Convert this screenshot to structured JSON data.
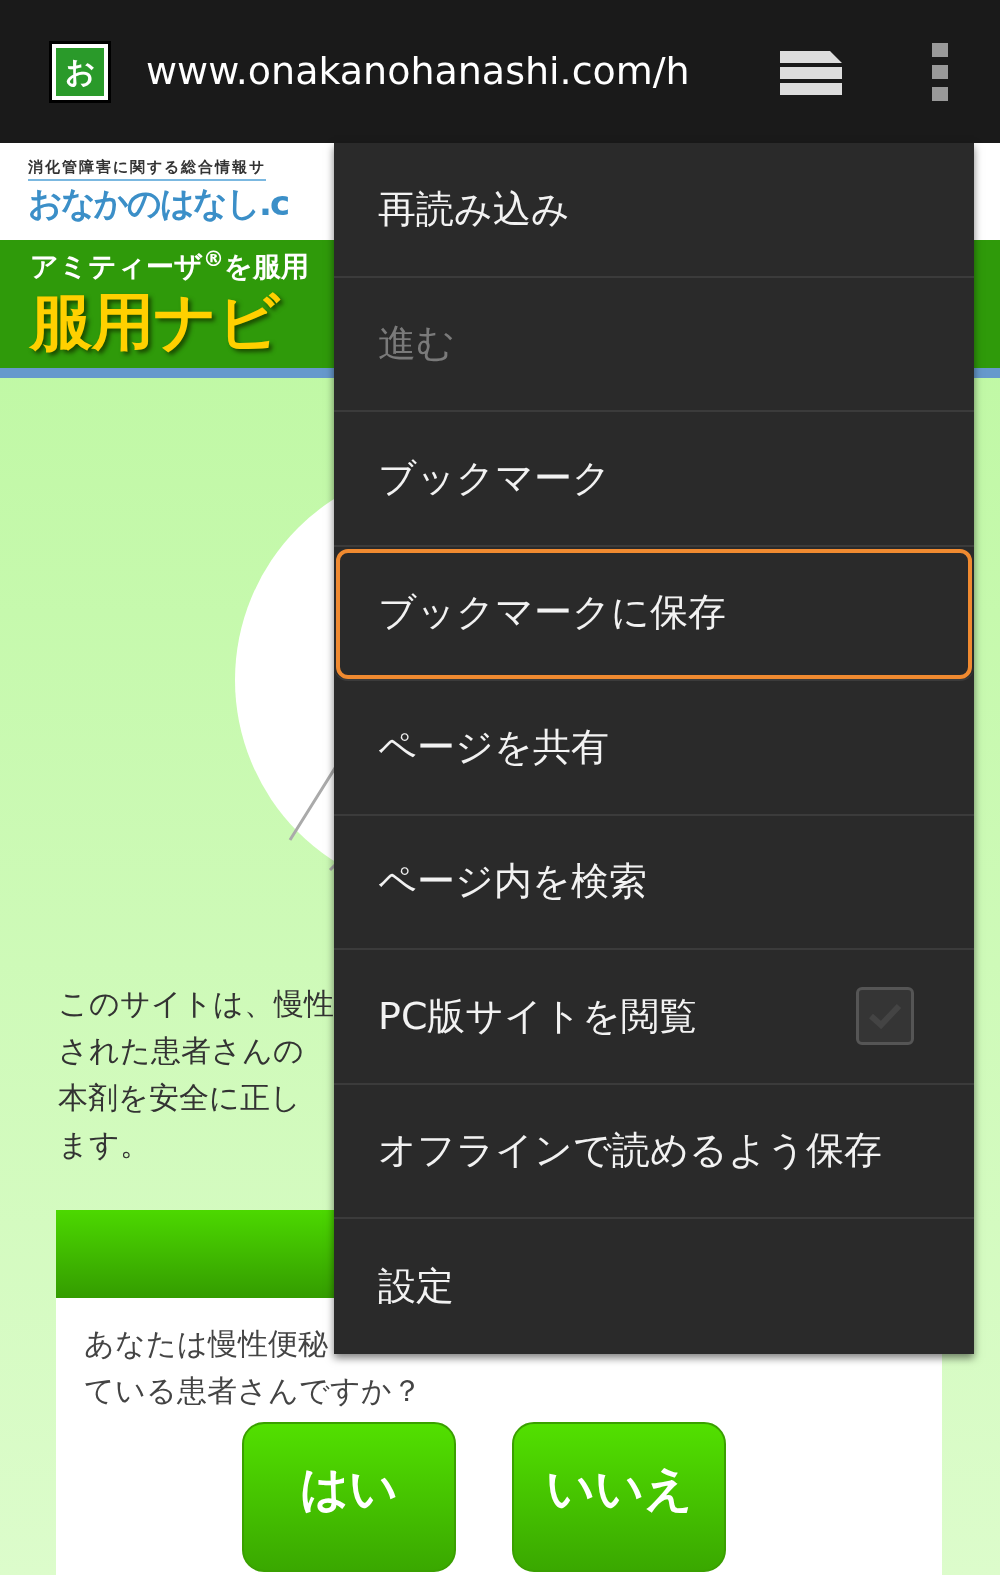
{
  "browser_bar": {
    "favicon": "お",
    "url": "www.onakanohanashi.com/h"
  },
  "site_header": {
    "tagline": "消化管障害に関する総合情報サ",
    "logo": "おなかのはなし.c"
  },
  "banner": {
    "subtitle": "アミティーザ$^{®}$を服用",
    "title": "服用ナビ"
  },
  "intro_lines": [
    "このサイトは、慢性",
    "された患者さんの",
    "本剤を安全に正し",
    "ます。"
  ],
  "question": {
    "lines": [
      "あなたは慢性便秘",
      "ている患者さんですか？"
    ]
  },
  "answer_buttons": [
    "はい",
    "いいえ"
  ],
  "menu": {
    "items": [
      {
        "label": "再読み込み",
        "kind": "plain",
        "disabled": false,
        "focused": false
      },
      {
        "label": "進む",
        "kind": "plain",
        "disabled": true,
        "focused": false
      },
      {
        "label": "ブックマーク",
        "kind": "plain",
        "disabled": false,
        "focused": false
      },
      {
        "label": "ブックマークに保存",
        "kind": "plain",
        "disabled": false,
        "focused": true
      },
      {
        "label": "ページを共有",
        "kind": "plain",
        "disabled": false,
        "focused": false
      },
      {
        "label": "ページ内を検索",
        "kind": "plain",
        "disabled": false,
        "focused": false
      },
      {
        "label": "PC版サイトを閲覧",
        "kind": "checkbox",
        "checked": false,
        "disabled": false,
        "focused": false
      },
      {
        "label": "オフラインで読めるよう保存",
        "kind": "plain",
        "disabled": false,
        "focused": false
      },
      {
        "label": "設定",
        "kind": "plain",
        "disabled": false,
        "focused": false
      }
    ]
  }
}
